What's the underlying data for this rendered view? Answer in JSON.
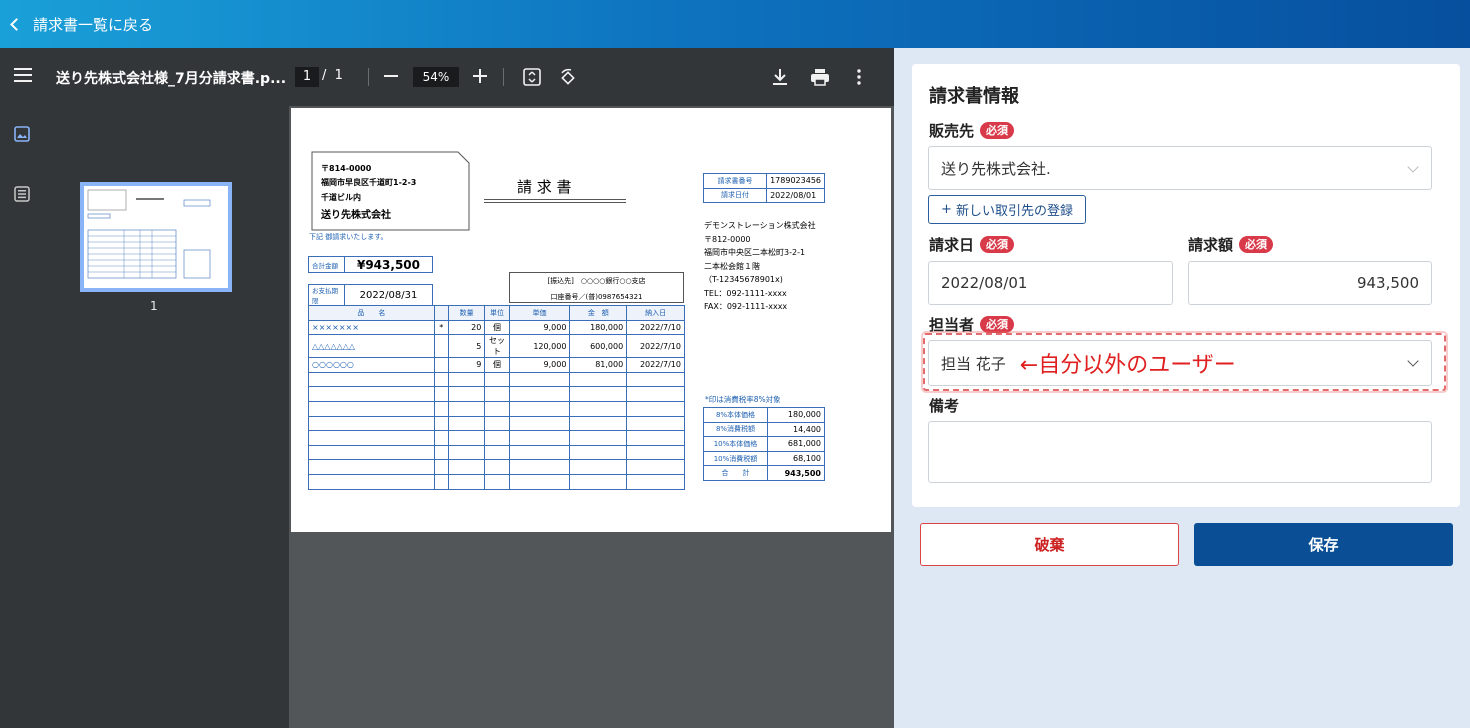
{
  "header": {
    "back_label": "請求書一覧に戻る"
  },
  "viewer": {
    "filename": "送り先株式会社様_7月分請求書.p...",
    "page_current": "1",
    "page_total": "1",
    "zoom": "54%",
    "thumb_page_number": "1",
    "icons": [
      "menu-icon",
      "minus-icon",
      "plus-icon",
      "fit-page-icon",
      "rotate-icon",
      "download-icon",
      "print-icon",
      "more-icon",
      "image-icon",
      "outline-icon"
    ]
  },
  "invoice": {
    "postal": "〒814-0000",
    "address1": "福岡市早良区千道町1-2-3",
    "address2": "千道ビル内",
    "recipient": "送り先株式会社",
    "title": "請 求 書",
    "note": "下記 御請求いたします。",
    "total_label": "合計金額",
    "total_value": "¥943,500",
    "due_label": "お支払期限",
    "due_value": "2022/08/31",
    "bank_line1": "[振込先]　○○○○銀行○○支店",
    "bank_line2": "口座番号／(普)0987654321",
    "no_label": "請求書番号",
    "no_value": "1789023456",
    "date_label": "請求日付",
    "date_value": "2022/08/01",
    "sender_name": "デモンストレーション株式会社",
    "sender_postal": "〒812-0000",
    "sender_addr": "福岡市中央区二本松町3-2-1",
    "sender_bldg": "二本松会館１階",
    "sender_reg": "（T-12345678901x)",
    "sender_tel": "TEL：092-1111-xxxx",
    "sender_fax": "FAX：092-1111-xxxx",
    "cols": [
      "品　　名",
      "",
      "数量",
      "単位",
      "単価",
      "金　額",
      "納入日"
    ],
    "rows": [
      [
        "×××××××",
        "*",
        "20",
        "個",
        "9,000",
        "180,000",
        "2022/7/10"
      ],
      [
        "△△△△△△△",
        "",
        "5",
        "セット",
        "120,000",
        "600,000",
        "2022/7/10"
      ],
      [
        "○○○○○○",
        "",
        "9",
        "個",
        "9,000",
        "81,000",
        "2022/7/10"
      ]
    ],
    "tax_note": "*印は消費税率8%対象",
    "summary": [
      [
        "8%本体価格",
        "180,000"
      ],
      [
        "8%消費税額",
        "14,400"
      ],
      [
        "10%本体価格",
        "681,000"
      ],
      [
        "10%消費税額",
        "68,100"
      ],
      [
        "合　　計",
        "943,500"
      ]
    ]
  },
  "form": {
    "title": "請求書情報",
    "required_badge": "必須",
    "vendor_label": "販売先",
    "vendor_value": "送り先株式会社.",
    "new_partner_button": "新しい取引先の登録",
    "date_label": "請求日",
    "date_value": "2022/08/01",
    "amount_label": "請求額",
    "amount_value": "943,500",
    "person_label": "担当者",
    "person_value": "担当 花子",
    "annotation": "←自分以外のユーザー",
    "memo_label": "備考",
    "memo_value": ""
  },
  "actions": {
    "discard": "破棄",
    "save": "保存"
  },
  "colors": {
    "accent": "#0a4f95",
    "required": "#d93a49",
    "annotation": "#e02020"
  }
}
